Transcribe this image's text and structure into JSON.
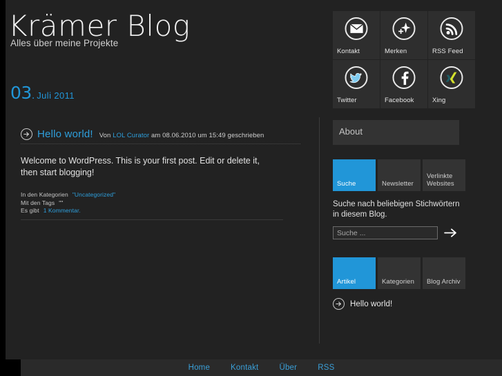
{
  "header": {
    "title": "Krämer Blog",
    "tagline": "Alles über meine Projekte",
    "date_day": "03",
    "date_dot": ".",
    "date_rest": "Juli 2011"
  },
  "post": {
    "title": "Hello world!",
    "byline_prefix": "Von",
    "author": "LOL Curator",
    "byline_suffix": "am 08.06.2010 um 15:49 geschrieben",
    "body": "Welcome to WordPress. This is your first post. Edit or delete it, then start blogging!",
    "meta": {
      "categories_label": "In den Kategorien",
      "categories_value": "\"Uncategorized\"",
      "tags_label": "Mit den Tags",
      "tags_value": "\"\"",
      "comments_label": "Es gibt",
      "comments_value": "1 Kommentar.",
      "arrow_icon": "arrow-right-circle-icon"
    }
  },
  "sidebar": {
    "social": [
      {
        "label": "Kontakt",
        "icon": "envelope-icon"
      },
      {
        "label": "Merken",
        "icon": "star-plus-icon"
      },
      {
        "label": "RSS Feed",
        "icon": "rss-icon"
      },
      {
        "label": "Twitter",
        "icon": "twitter-bird-icon"
      },
      {
        "label": "Facebook",
        "icon": "facebook-f-icon"
      },
      {
        "label": "Xing",
        "icon": "xing-x-icon"
      }
    ],
    "about": {
      "label": "About"
    },
    "search_tabs": [
      {
        "label": "Suche",
        "active": true
      },
      {
        "label": "Newsletter",
        "active": false
      },
      {
        "label": "Verlinkte Websites",
        "active": false
      }
    ],
    "search": {
      "description": "Suche nach beliebigen Stichwörtern in diesem Blog.",
      "placeholder": "Suche ...",
      "value": "",
      "submit_icon": "arrow-right-icon"
    },
    "article_tabs": [
      {
        "label": "Artikel",
        "active": true
      },
      {
        "label": "Kategorien",
        "active": false
      },
      {
        "label": "Blog Archiv",
        "active": false
      }
    ],
    "articles": [
      {
        "label": "Hello world!",
        "icon": "arrow-right-circle-icon"
      }
    ]
  },
  "footer": {
    "links": [
      "Home",
      "Kontakt",
      "Über",
      "RSS"
    ]
  },
  "colors": {
    "accent": "#2196d8",
    "link": "#2e9fdc",
    "surface": "#222222",
    "tile": "#333333",
    "social_tile": "#2e2e2e",
    "footer": "#2a2a2a",
    "page_bg": "#000000"
  }
}
